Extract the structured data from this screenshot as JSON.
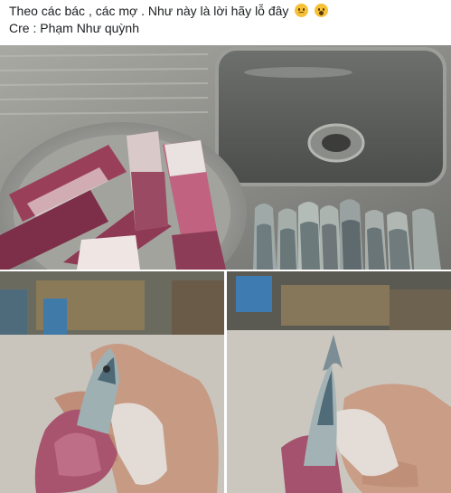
{
  "post": {
    "line1": "Theo các bác , các mợ . Như này là lời hãy lỗ đây",
    "line1_emojis": [
      "disappointed-face",
      "astonished-face"
    ],
    "line2": "Cre : Phạm Như quỳnh"
  },
  "photos": [
    {
      "name": "squid-and-fish-on-sink"
    },
    {
      "name": "fish-stuffed-in-squid-left"
    },
    {
      "name": "fish-stuffed-in-squid-right"
    }
  ]
}
